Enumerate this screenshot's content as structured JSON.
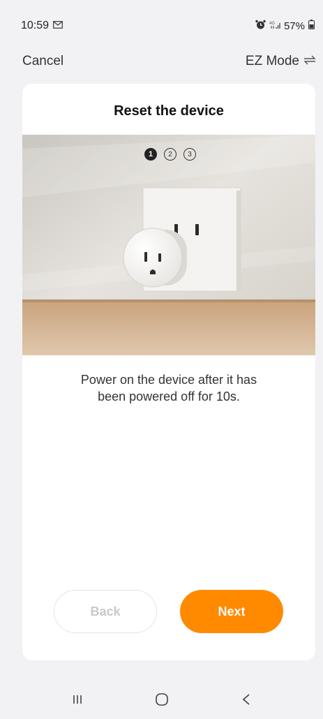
{
  "status": {
    "time": "10:59",
    "battery": "57%"
  },
  "header": {
    "cancel_label": "Cancel",
    "mode_label": "EZ Mode",
    "mode_icon": "swap-arrows-icon"
  },
  "card": {
    "title": "Reset the device",
    "steps": [
      "1",
      "2",
      "3"
    ],
    "active_step": "1",
    "instruction_line1": "Power on the device after it has",
    "instruction_line2": "been powered off for 10s."
  },
  "actions": {
    "back_label": "Back",
    "next_label": "Next"
  },
  "colors": {
    "accent": "#ff8a00",
    "background": "#f2f2f4",
    "card": "#ffffff"
  }
}
